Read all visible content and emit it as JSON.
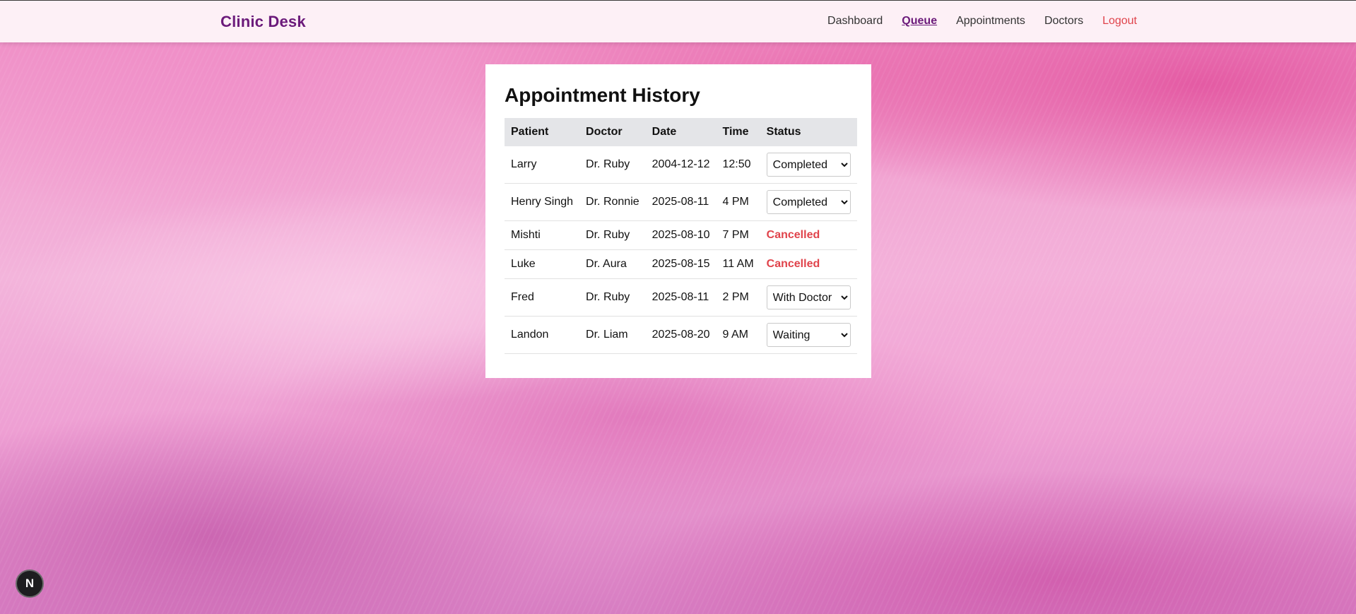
{
  "header": {
    "brand": "Clinic Desk",
    "nav": [
      {
        "label": "Dashboard",
        "active": false
      },
      {
        "label": "Queue",
        "active": true
      },
      {
        "label": "Appointments",
        "active": false
      },
      {
        "label": "Doctors",
        "active": false
      },
      {
        "label": "Logout",
        "active": false
      }
    ]
  },
  "main": {
    "title": "Appointment History",
    "columns": [
      "Patient",
      "Doctor",
      "Date",
      "Time",
      "Status"
    ],
    "rows": [
      {
        "patient": "Larry",
        "doctor": "Dr. Ruby",
        "date": "2004-12-12",
        "time": "12:50",
        "status": "Completed",
        "editable": true
      },
      {
        "patient": "Henry Singh",
        "doctor": "Dr. Ronnie",
        "date": "2025-08-11",
        "time": "4 PM",
        "status": "Completed",
        "editable": true
      },
      {
        "patient": "Mishti",
        "doctor": "Dr. Ruby",
        "date": "2025-08-10",
        "time": "7 PM",
        "status": "Cancelled",
        "editable": false
      },
      {
        "patient": "Luke",
        "doctor": "Dr. Aura",
        "date": "2025-08-15",
        "time": "11 AM",
        "status": "Cancelled",
        "editable": false
      },
      {
        "patient": "Fred",
        "doctor": "Dr. Ruby",
        "date": "2025-08-11",
        "time": "2 PM",
        "status": "With Doctor",
        "editable": true
      },
      {
        "patient": "Landon",
        "doctor": "Dr. Liam",
        "date": "2025-08-20",
        "time": "9 AM",
        "status": "Waiting",
        "editable": true
      }
    ]
  },
  "badge": {
    "label": "N"
  },
  "colors": {
    "brand": "#6b1a7a",
    "logout": "#e0434b",
    "cancelled": "#e0434b",
    "header_bg": "#fdf0f6",
    "table_header_bg": "#e4e5e8"
  }
}
